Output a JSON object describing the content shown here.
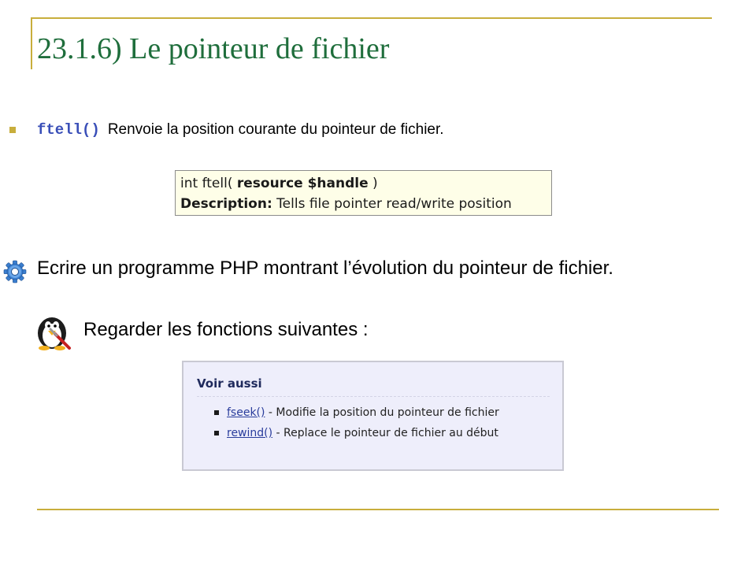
{
  "slide": {
    "title": "23.1.6) Le pointeur de fichier"
  },
  "bullet": {
    "function_name": "ftell()",
    "description": "Renvoie  la position courante du pointeur de fichier."
  },
  "signature_box": {
    "prefix": "int ftell( ",
    "param": "resource $handle",
    "suffix": " )",
    "desc_label": "Description:",
    "desc_text": " Tells file pointer read/write position"
  },
  "exercise": {
    "icon": "gear-icon",
    "text": "Ecrire un programme PHP  montrant l’évolution du pointeur de fichier."
  },
  "hint": {
    "icon": "penguin-icon",
    "text": "Regarder les fonctions suivantes :"
  },
  "see_also": {
    "title": "Voir aussi",
    "items": [
      {
        "link": "fseek()",
        "text": " - Modifie la position du pointeur de fichier"
      },
      {
        "link": "rewind()",
        "text": " - Replace le pointeur de fichier au début"
      }
    ]
  },
  "colors": {
    "title": "#1f6e3c",
    "rule": "#c8ae3c",
    "function": "#3a4fb8"
  }
}
